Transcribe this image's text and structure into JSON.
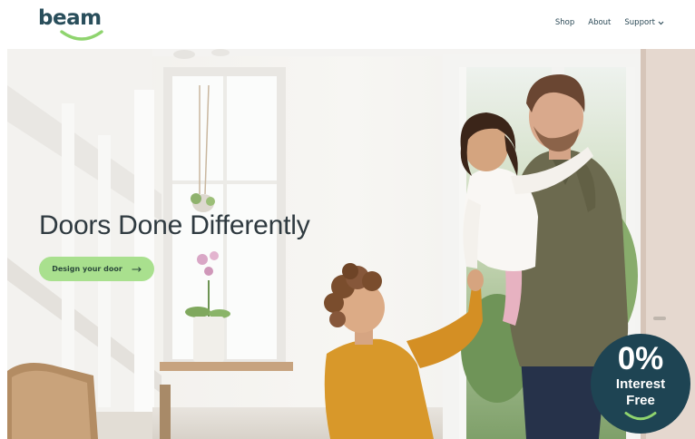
{
  "brand": {
    "logo_text": "beam",
    "brand_navy": "#294e5b",
    "brand_green": "#8fd46e"
  },
  "nav": {
    "items": [
      {
        "label": "Shop"
      },
      {
        "label": "About"
      },
      {
        "label": "Support",
        "has_dropdown": true
      }
    ]
  },
  "hero": {
    "title": "Doors Done Differently",
    "cta_label": "Design your door",
    "cta_color": "#a9e08e"
  },
  "badge": {
    "big": "0%",
    "line1": "Interest",
    "line2": "Free",
    "bg_color": "#1e4453"
  },
  "icons": [
    "logo-smile-icon",
    "chevron-down-icon",
    "arrow-right-icon",
    "badge-smile-icon"
  ]
}
